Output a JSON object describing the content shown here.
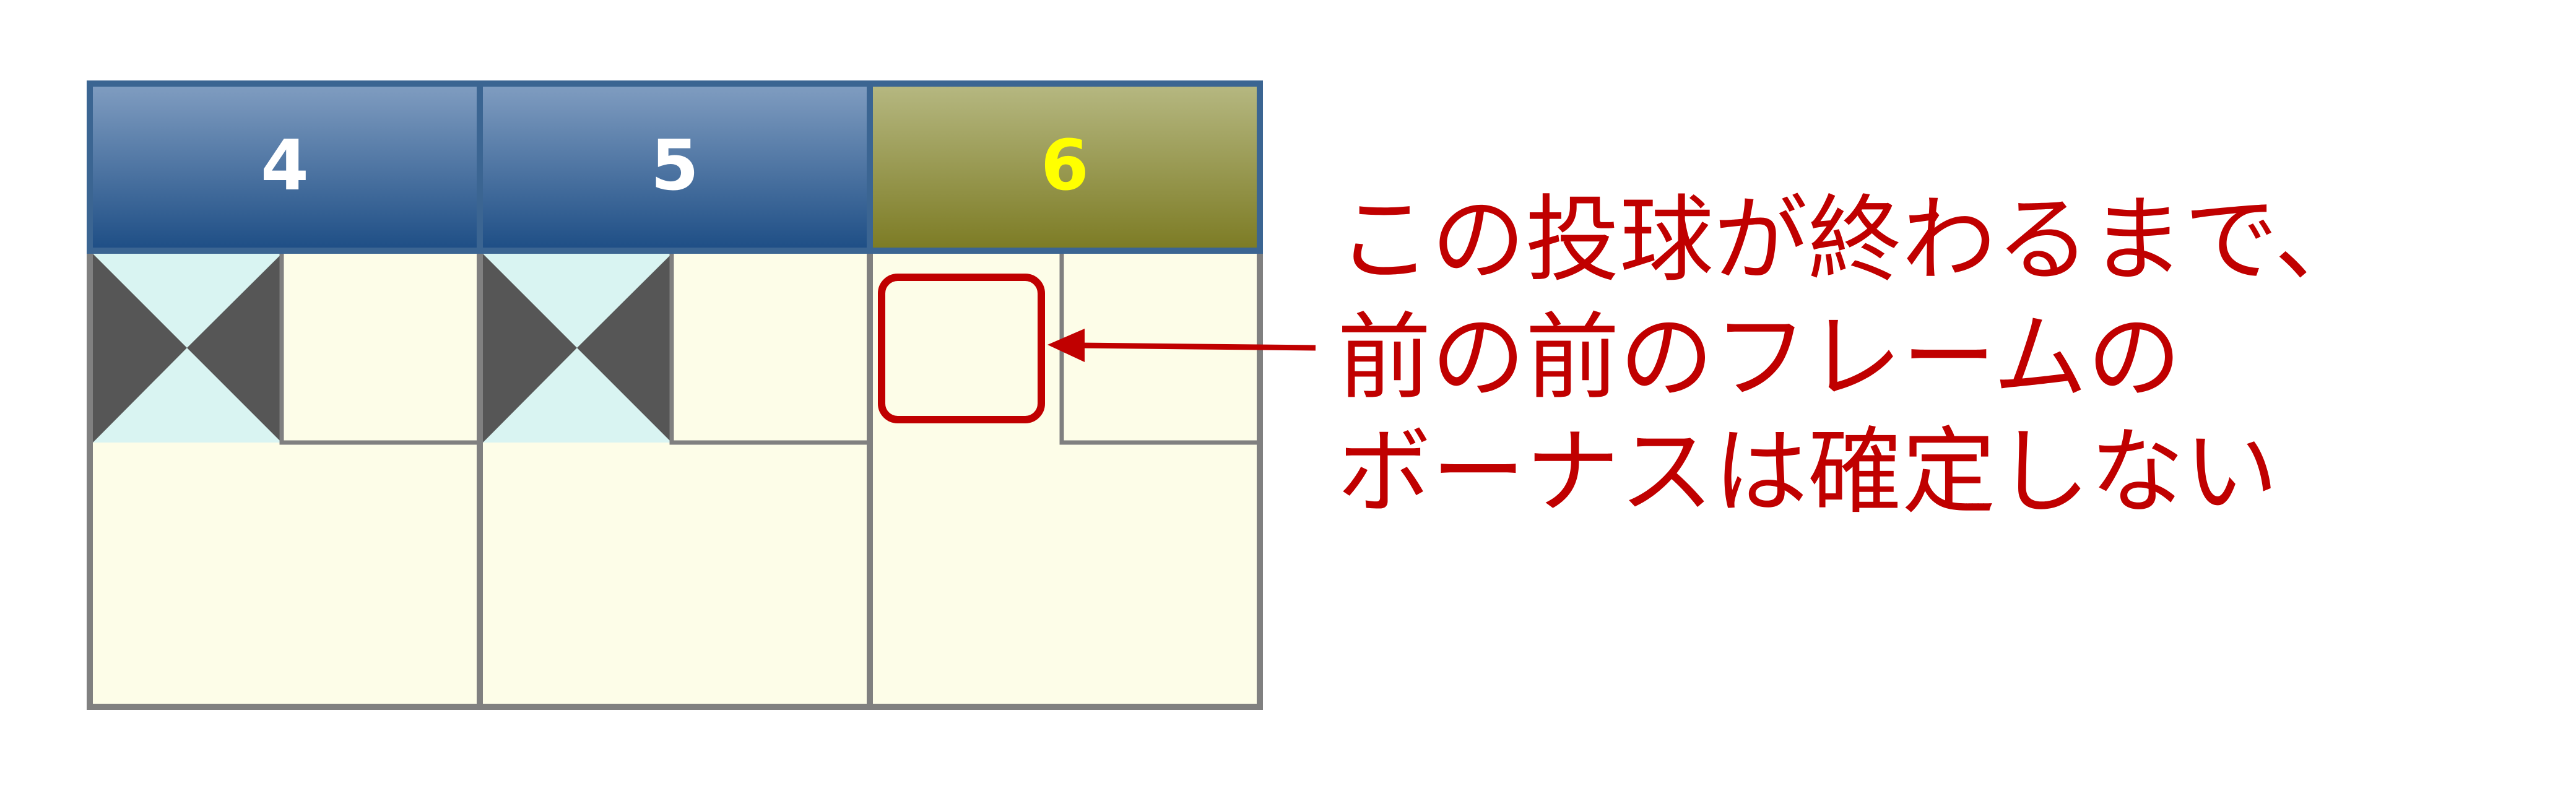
{
  "scoresheet": {
    "frames": [
      {
        "number": "4",
        "first_ball": "strike",
        "current": false
      },
      {
        "number": "5",
        "first_ball": "strike",
        "current": false
      },
      {
        "number": "6",
        "first_ball": "",
        "current": true
      }
    ]
  },
  "annotation": {
    "lines": [
      "この投球が終わるまで、",
      "前の前のフレームの",
      "ボーナスは確定しない"
    ]
  },
  "colors": {
    "header_blue_top": "#7f9cc0",
    "header_blue_bottom": "#1f4f86",
    "header_olive_top": "#b5b780",
    "header_olive_bottom": "#7d7c25",
    "current_number": "#ffff00",
    "other_number": "#ffffff",
    "cell_background": "#fdfde8",
    "strike_light": "#d9f4f2",
    "strike_dark": "#565656",
    "highlight_red": "#c00000",
    "grid_gray": "#808080",
    "outer_border": "#3b6592"
  }
}
